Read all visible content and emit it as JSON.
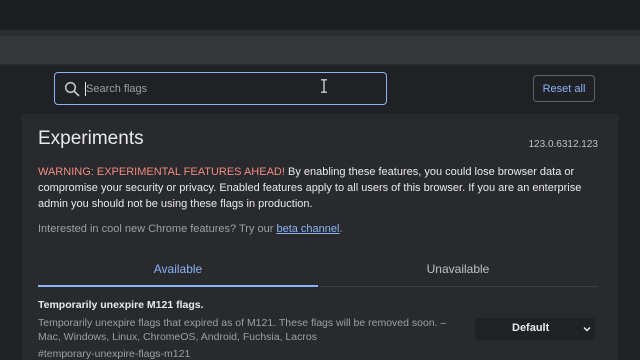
{
  "search": {
    "placeholder": "Search flags"
  },
  "header": {
    "reset_label": "Reset all"
  },
  "page": {
    "title": "Experiments",
    "version": "123.0.6312.123"
  },
  "warning": {
    "label": "WARNING: EXPERIMENTAL FEATURES AHEAD!",
    "text": " By enabling these features, you could lose browser data or compromise your security or privacy. Enabled features apply to all users of this browser. If you are an enterprise admin you should not be using these flags in production."
  },
  "promo": {
    "text": "Interested in cool new Chrome features? Try our ",
    "link": "beta channel",
    "suffix": "."
  },
  "tabs": [
    {
      "label": "Available",
      "active": true
    },
    {
      "label": "Unavailable",
      "active": false
    }
  ],
  "flags": [
    {
      "title": "Temporarily unexpire M121 flags.",
      "description": "Temporarily unexpire flags that expired as of M121. These flags will be removed soon. – Mac, Windows, Linux, ChromeOS, Android, Fuchsia, Lacros",
      "anchor": "#temporary-unexpire-flags-m121",
      "selected": "Default"
    }
  ],
  "colors": {
    "accent": "#8ab4f8",
    "warning": "#f28b82",
    "background": "#202124",
    "panel": "#292a2d"
  },
  "icons": {
    "search": "search-icon",
    "cursor": "text-cursor-icon",
    "dropdown": "chevron-down-icon"
  }
}
